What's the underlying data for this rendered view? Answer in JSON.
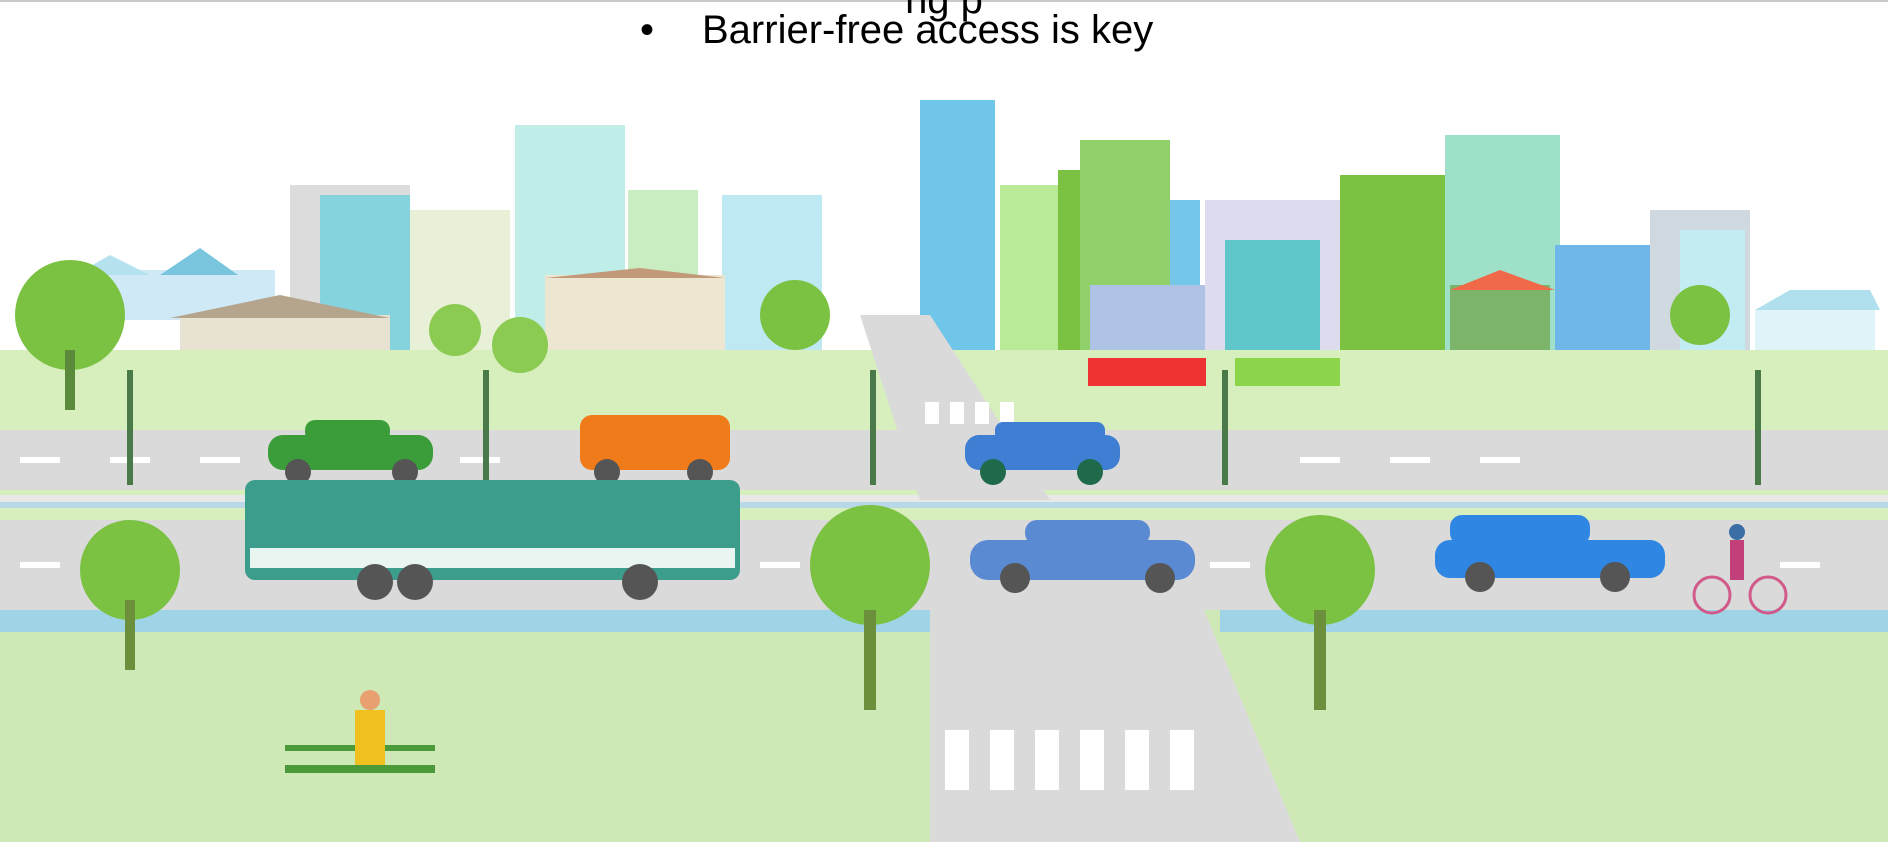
{
  "slide": {
    "partial_heading": "ng p",
    "bullet_symbol": "•",
    "bullet_text": "Barrier-free access is key"
  },
  "illustration": {
    "icon": "city-street-illustration-icon",
    "colors": {
      "sky": "#ffffff",
      "grass": "#c8e6a6",
      "road": "#d8d8d8",
      "lane_mark": "#ffffff",
      "bike_lane": "#9fd3e6",
      "tree_green": "#7cc242",
      "bus": "#3c9d8c",
      "car_blue": "#3f7fd3",
      "car_green": "#3a9d3a",
      "van_orange": "#f07b1a"
    }
  }
}
